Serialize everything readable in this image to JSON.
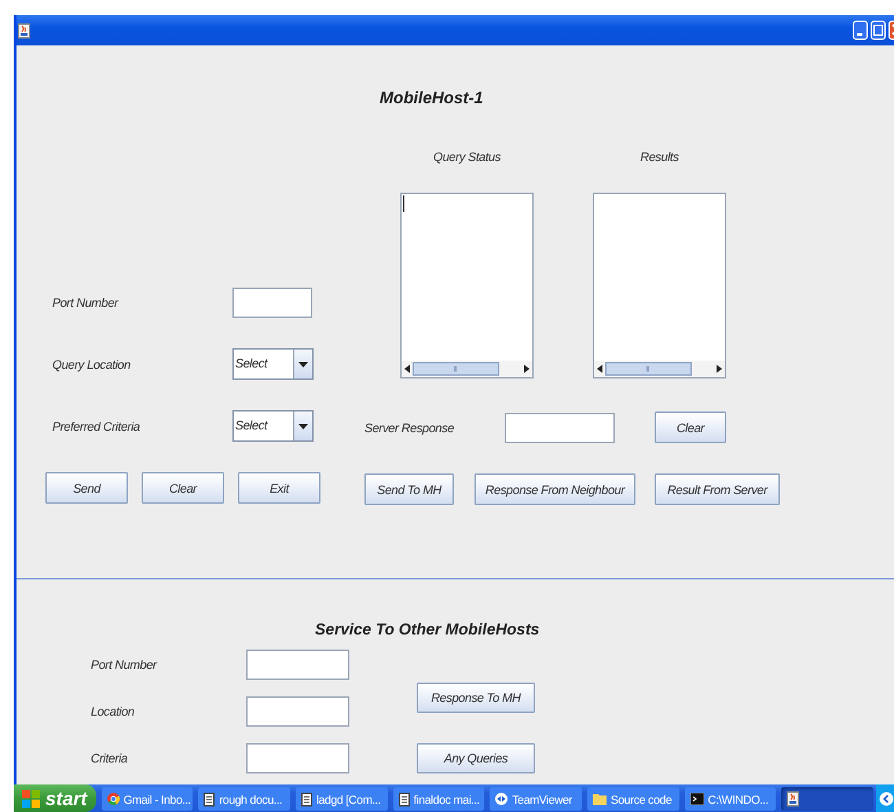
{
  "main": {
    "title": "MobileHost-1",
    "query_status": {
      "label": "Query Status",
      "focused": true
    },
    "results": {
      "label": "Results"
    },
    "port_number": {
      "label": "Port Number"
    },
    "query_location": {
      "label": "Query Location",
      "value": "Select"
    },
    "preferred_criteria": {
      "label": "Preferred Criteria",
      "value": "Select"
    },
    "server_response": {
      "label": "Server Response"
    },
    "clear_button": "Clear",
    "buttons": [
      "Send",
      "Clear",
      "Exit"
    ],
    "actions": [
      "Send To MH",
      "Response From Neighbour",
      "Result From Server"
    ]
  },
  "service": {
    "title": "Service To Other MobileHosts",
    "fields": [
      {
        "label": "Port Number"
      },
      {
        "label": "Location"
      },
      {
        "label": "Criteria"
      }
    ],
    "buttons": [
      "Response To MH",
      "Any Queries"
    ]
  },
  "taskbar": {
    "start": "start",
    "items": [
      {
        "kind": "browser",
        "label": "Gmail - Inbo...",
        "selected": false
      },
      {
        "kind": "document",
        "label": "rough docu...",
        "selected": false
      },
      {
        "kind": "document",
        "label": "ladgd [Com...",
        "selected": false
      },
      {
        "kind": "document",
        "label": "finaldoc mai...",
        "selected": false
      },
      {
        "kind": "remote",
        "label": "TeamViewer",
        "selected": false
      },
      {
        "kind": "folder",
        "label": "Source code",
        "selected": false
      },
      {
        "kind": "console",
        "label": "C:\\WINDO...",
        "selected": false
      },
      {
        "kind": "app",
        "selected": true
      }
    ]
  }
}
